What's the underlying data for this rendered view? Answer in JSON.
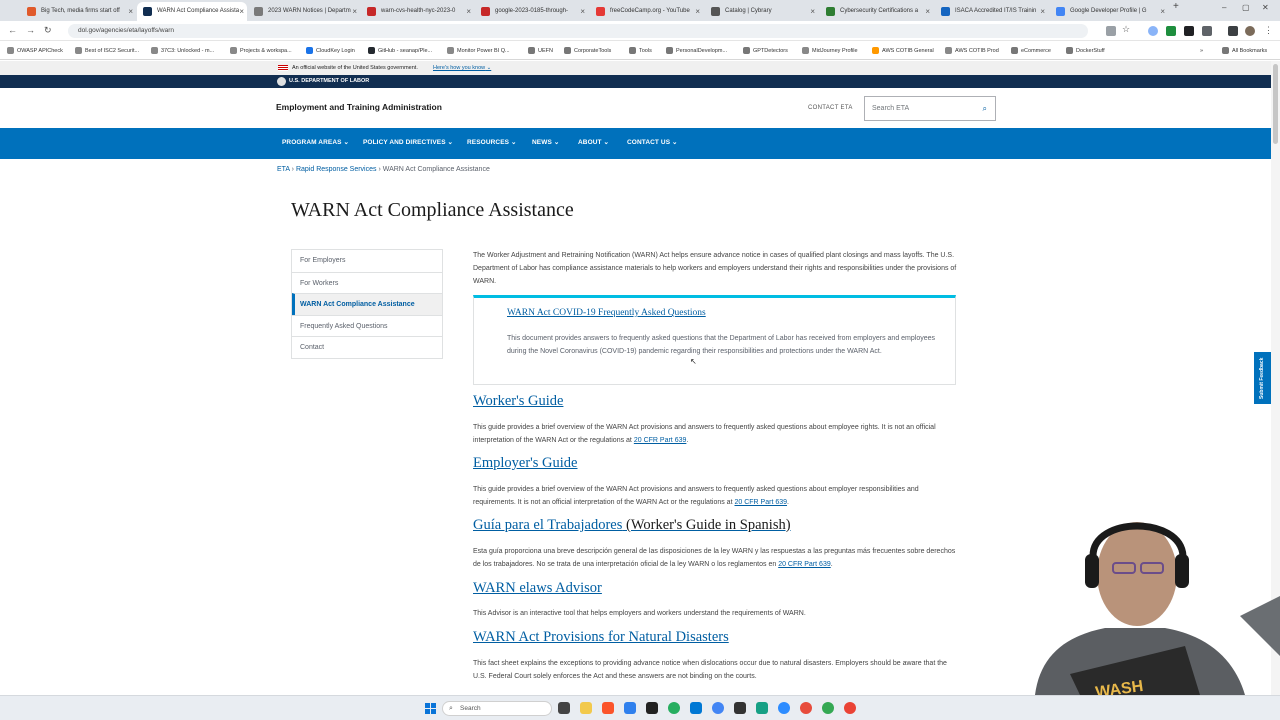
{
  "browser": {
    "tabs": [
      {
        "label": "Big Tech, media firms start off",
        "color": "#e05a2b",
        "active": false
      },
      {
        "label": "WARN Act Compliance Assista",
        "color": "#112e51",
        "active": true
      },
      {
        "label": "2023 WARN Notices | Departm",
        "color": "#7a7a7a",
        "active": false
      },
      {
        "label": "warn-cvs-health-nyc-2023-0",
        "color": "#c62828",
        "active": false
      },
      {
        "label": "google-2023-0185-through-",
        "color": "#c62828",
        "active": false
      },
      {
        "label": "freeCodeCamp.org - YouTube",
        "color": "#e53935",
        "active": false
      },
      {
        "label": "Catalog | Cybrary",
        "color": "#555555",
        "active": false
      },
      {
        "label": "Cybersecurity Certifications a",
        "color": "#2e7d32",
        "active": false
      },
      {
        "label": "ISACA Accredited IT/IS Trainin",
        "color": "#1565c0",
        "active": false
      },
      {
        "label": "Google Developer Profile | G",
        "color": "#4285f4",
        "active": false
      }
    ],
    "new_tab": "+",
    "url": "dol.gov/agencies/eta/layoffs/warn",
    "bookmarks": [
      "OWASP APICheck",
      "Best of ISC2 Securit...",
      "37C3: Unlocked - m...",
      "Projects & workspa...",
      "CloudKey Login",
      "GitHub - seanap/Ple...",
      "Monitor Power BI Q...",
      "UEFN",
      "CorporateTools",
      "Tools",
      "PersonalDevelopm...",
      "GPTDetectors",
      "MidJourney Profile",
      "AWS COTIB General",
      "AWS COTIB Prod",
      "eCommerce",
      "DockerStuff"
    ],
    "all_bookmarks": "All Bookmarks"
  },
  "site": {
    "gov_banner": "An official website of the United States government.",
    "gov_link": "Here's how you know",
    "agency": "U.S. DEPARTMENT OF LABOR",
    "subagency": "Employment and Training Administration",
    "contact_eta": "CONTACT ETA",
    "search_placeholder": "Search ETA",
    "nav": [
      "PROGRAM AREAS",
      "POLICY AND DIRECTIVES",
      "RESOURCES",
      "NEWS",
      "ABOUT",
      "CONTACT US"
    ],
    "breadcrumb": {
      "home": "ETA",
      "parent": "Rapid Response Services",
      "current": "WARN Act Compliance Assistance"
    },
    "page_title": "WARN Act Compliance Assistance",
    "side_nav": [
      "For Employers",
      "For Workers",
      "WARN Act Compliance Assistance",
      "Frequently Asked Questions",
      "Contact"
    ],
    "intro": "The Worker Adjustment and Retraining Notification (WARN) Act helps ensure advance notice in cases of qualified plant closings and mass layoffs. The U.S. Department of Labor has compliance assistance materials to help workers and employers understand their rights and responsibilities under the provisions of WARN.",
    "featured": {
      "title": "WARN Act COVID-19 Frequently Asked Questions",
      "body": "This document provides answers to frequently asked questions that the Department of Labor has received from employers and employees during the Novel Coronavirus (COVID-19) pandemic regarding their responsibilities and protections under the WARN Act."
    },
    "sections": {
      "worker": {
        "title": "Worker's Guide",
        "body": "This guide provides a brief overview of the WARN Act provisions and answers to frequently asked questions about employee rights. It is not an official interpretation of the WARN Act or the regulations at",
        "link": "20 CFR Part 639",
        "end": "."
      },
      "employer": {
        "title": "Employer's Guide",
        "body": "This guide provides a brief overview of the WARN Act provisions and answers to frequently asked questions about employer responsibilities and requirements. It is not an official interpretation of the WARN Act or the regulations at",
        "link": "20 CFR Part 639",
        "end": "."
      },
      "spanish": {
        "title": "Guía para el Trabajadores",
        "suffix": " (Worker's Guide in Spanish)",
        "body": "Esta guía proporciona una breve descripción general de las disposiciones de la ley WARN y las respuestas a las preguntas más frecuentes sobre derechos de los trabajadores. No se trata de una interpretación oficial de la ley WARN o los reglamentos en",
        "link": "20 CFR Part 639",
        "end": "."
      },
      "elaws": {
        "title": "WARN elaws Advisor",
        "body": "This Advisor is an interactive tool that helps employers and workers understand the requirements of WARN."
      },
      "disasters": {
        "title": "WARN Act Provisions for Natural Disasters",
        "body": "This fact sheet explains the exceptions to providing advance notice when dislocations occur due to natural disasters. Employers should be aware that the U.S. Federal Court solely enforces the Act and these answers are not binding on the courts."
      }
    },
    "feedback": "Submit Feedback"
  },
  "taskbar": {
    "search": "Search"
  }
}
